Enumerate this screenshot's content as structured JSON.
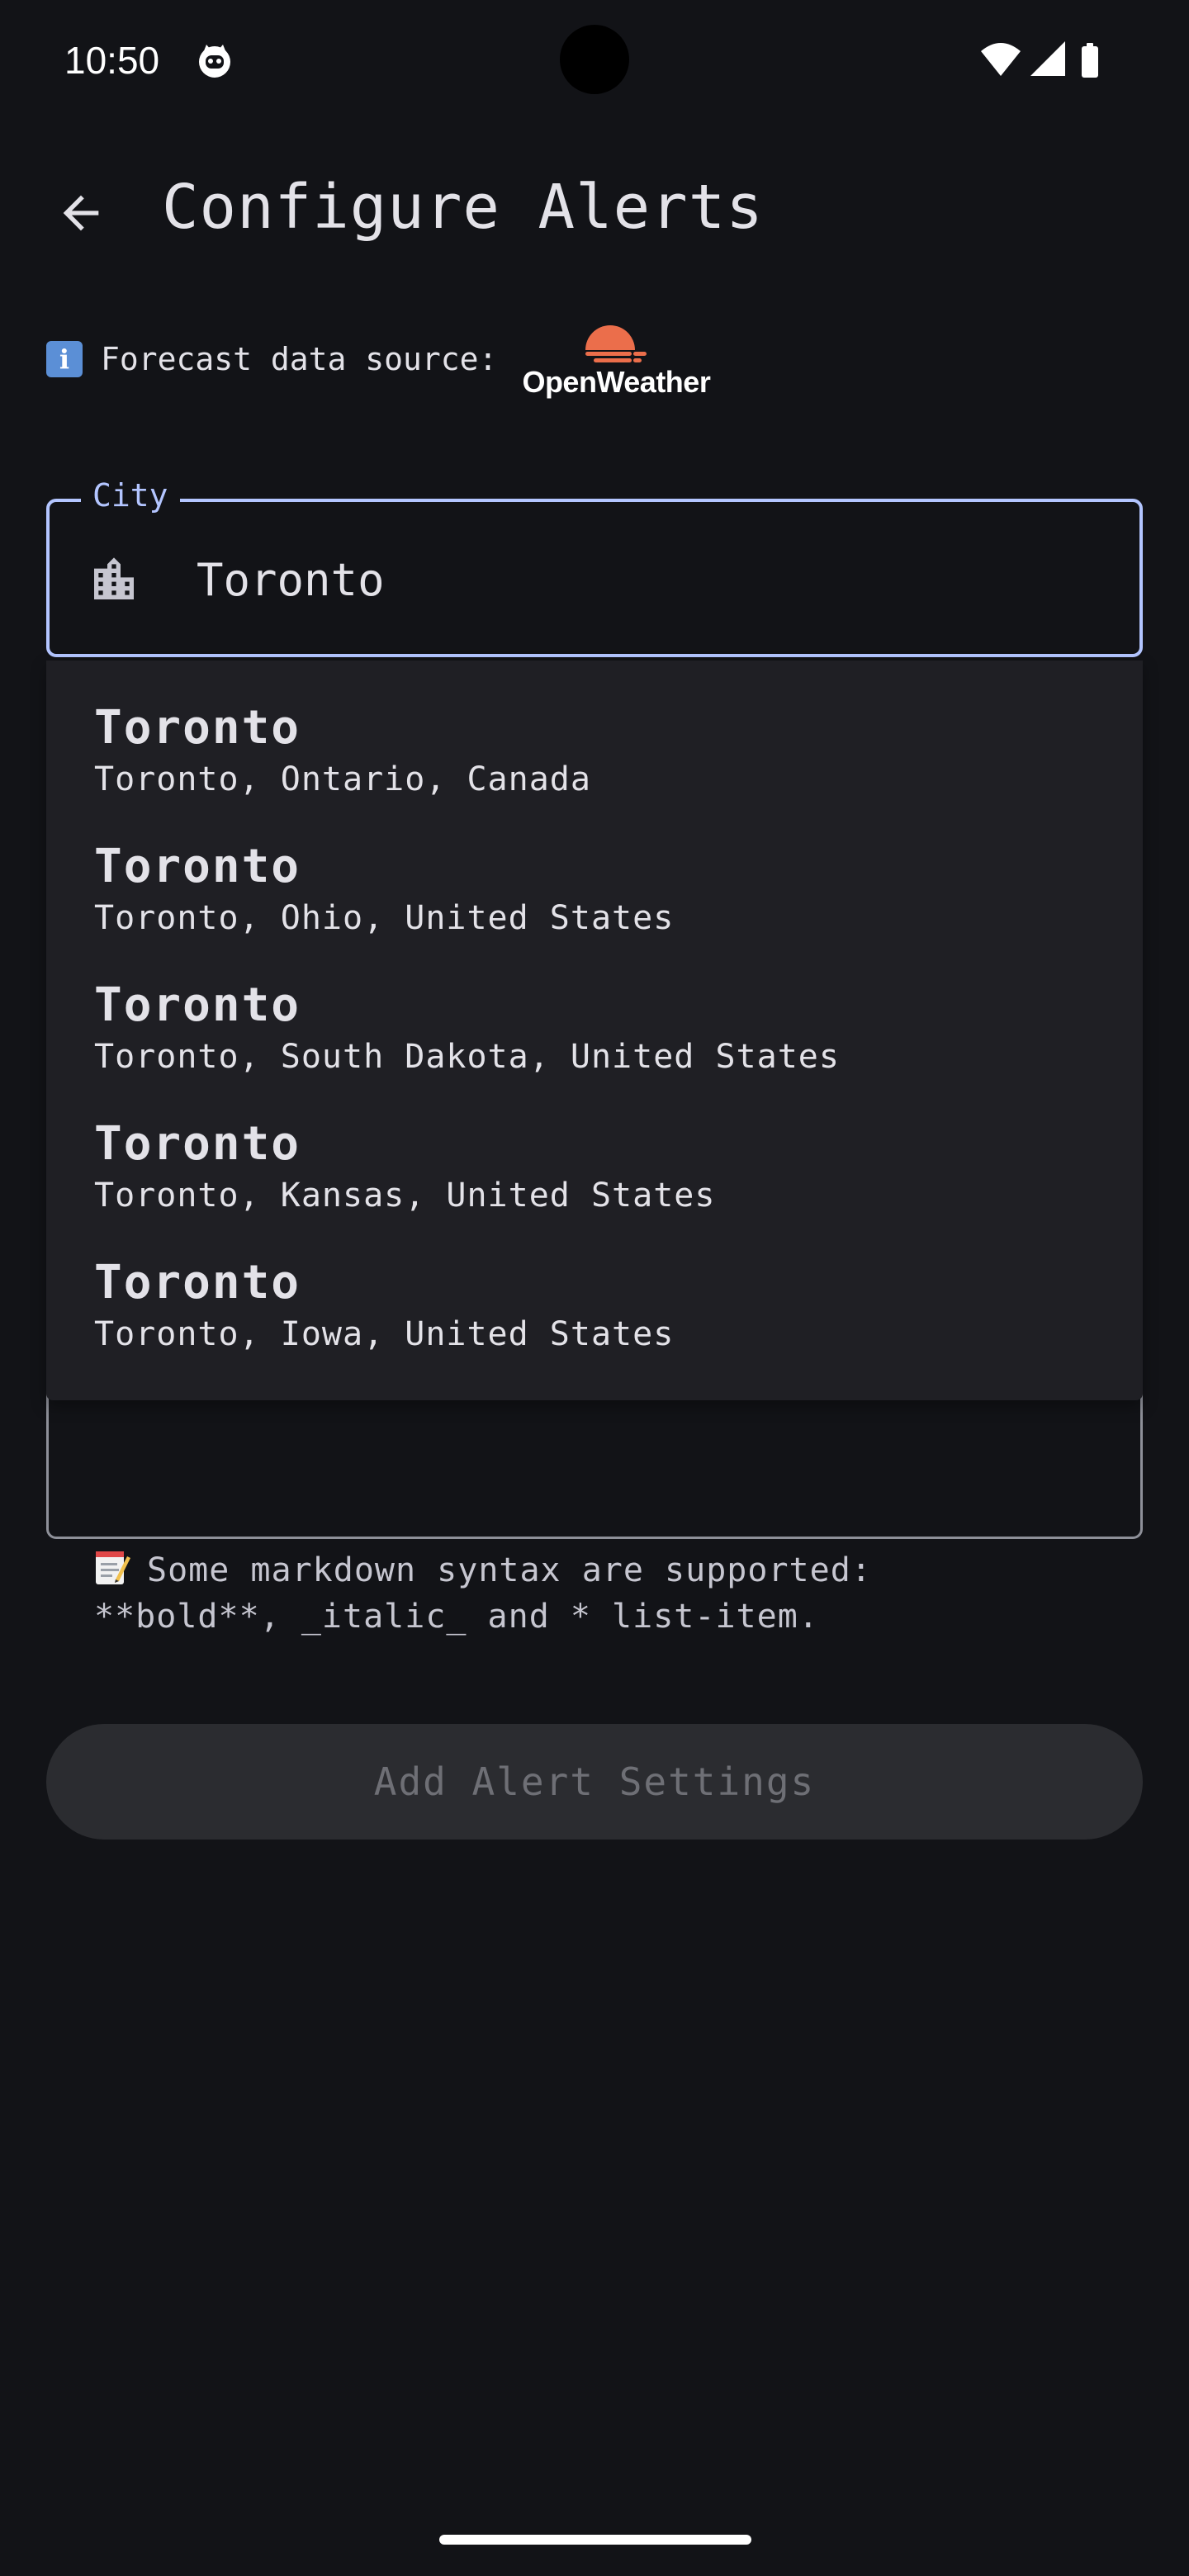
{
  "status_bar": {
    "time": "10:50",
    "icons": [
      "notification-cat-icon",
      "wifi-icon",
      "cellular-signal-icon",
      "battery-icon"
    ]
  },
  "app_bar": {
    "back_icon": "arrow-back-icon",
    "title": "Configure Alerts"
  },
  "data_source": {
    "info_emoji": "i",
    "label": "Forecast data source:",
    "provider_logo_text": "OpenWeather",
    "provider_color": "#eb6e4b"
  },
  "city_field": {
    "label": "City",
    "value": "Toronto",
    "icon": "city-building-icon",
    "accent_color": "#b3c5ff"
  },
  "suggestions": [
    {
      "title": "Toronto",
      "subtitle": "Toronto, Ontario, Canada"
    },
    {
      "title": "Toronto",
      "subtitle": "Toronto, Ohio, United States"
    },
    {
      "title": "Toronto",
      "subtitle": "Toronto, South Dakota, United States"
    },
    {
      "title": "Toronto",
      "subtitle": "Toronto, Kansas, United States"
    },
    {
      "title": "Toronto",
      "subtitle": "Toronto, Iowa, United States"
    }
  ],
  "markdown_hint": {
    "icon": "memo-icon",
    "line1": "Some markdown syntax are supported:",
    "line2": "**bold**, _italic_ and * list-item."
  },
  "add_button": {
    "label": "Add Alert Settings",
    "disabled": true
  }
}
